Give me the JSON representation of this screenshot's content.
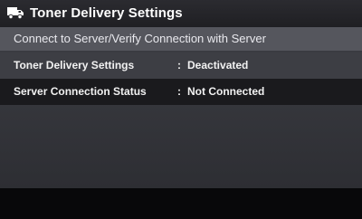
{
  "header": {
    "title": "Toner Delivery Settings",
    "icon": "delivery-truck-icon"
  },
  "subheader": {
    "text": "Connect to Server/Verify Connection with Server"
  },
  "rows": [
    {
      "label": "Toner Delivery Settings",
      "separator": ":",
      "value": "Deactivated"
    },
    {
      "label": "Server Connection Status",
      "separator": ":",
      "value": "Not Connected"
    }
  ],
  "colors": {
    "title_bar": "#2b2b30",
    "subheader_bar": "#55565d",
    "row_selected": "#3d3e44",
    "row_dark": "#1a1a1d"
  }
}
